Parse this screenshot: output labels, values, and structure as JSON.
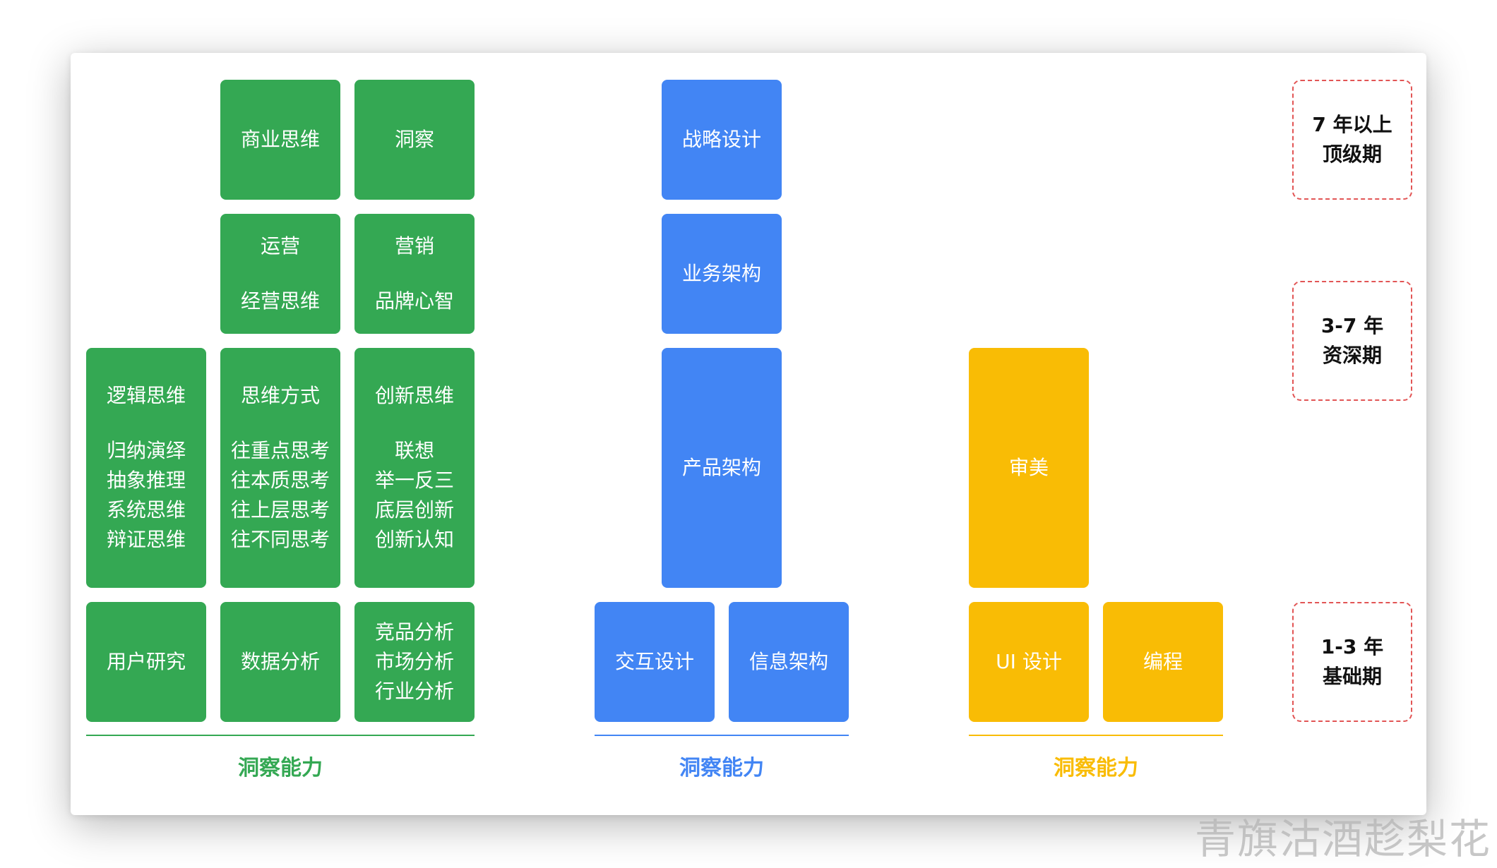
{
  "green_group": {
    "row_top": {
      "business_thinking": "商业思维",
      "insight": "洞察"
    },
    "row_second": {
      "operations": {
        "title": "运营",
        "sub": "经营思维"
      },
      "marketing": {
        "title": "营销",
        "sub": "品牌心智"
      }
    },
    "row_third": {
      "logic": {
        "title": "逻辑思维",
        "lines": [
          "归纳演绎",
          "抽象推理",
          "系统思维",
          "辩证思维"
        ]
      },
      "thinking_mode": {
        "title": "思维方式",
        "lines": [
          "往重点思考",
          "往本质思考",
          "往上层思考",
          "往不同思考"
        ]
      },
      "innovation": {
        "title": "创新思维",
        "lines": [
          "联想",
          "举一反三",
          "底层创新",
          "创新认知"
        ]
      }
    },
    "row_bottom": {
      "user_research": "用户研究",
      "data_analysis": "数据分析",
      "analysis_lines": [
        "竞品分析",
        "市场分析",
        "行业分析"
      ]
    },
    "label": "洞察能力",
    "color": "#34a853"
  },
  "blue_group": {
    "strategy_design": "战略设计",
    "business_architecture": "业务架构",
    "product_architecture": "产品架构",
    "interaction_design": "交互设计",
    "information_architecture": "信息架构",
    "label": "洞察能力",
    "color": "#4285f4"
  },
  "yellow_group": {
    "aesthetics": "审美",
    "ui_design": "UI 设计",
    "programming": "编程",
    "label": "洞察能力",
    "color": "#f9bc05"
  },
  "stages": {
    "top": {
      "line1": "7 年以上",
      "line2": "顶级期"
    },
    "middle": {
      "line1": "3-7 年",
      "line2": "资深期"
    },
    "bottom": {
      "line1": "1-3 年",
      "line2": "基础期"
    },
    "border_color": "#e25555"
  },
  "watermark": "青旗沽酒趁梨花"
}
